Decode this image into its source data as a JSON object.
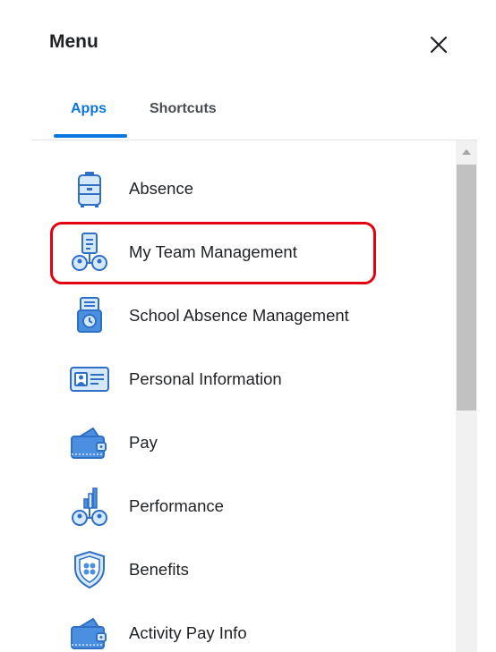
{
  "header": {
    "title": "Menu",
    "close_icon": "close-icon"
  },
  "tabs": [
    {
      "label": "Apps",
      "active": true
    },
    {
      "label": "Shortcuts",
      "active": false
    }
  ],
  "colors": {
    "accent": "#0875e1",
    "highlight": "#e3000f",
    "icon_blue": "#4a8fe0",
    "icon_light": "#d6e8fb"
  },
  "apps": [
    {
      "label": "Absence",
      "icon": "suitcase-icon"
    },
    {
      "label": "My Team Management",
      "icon": "team-clipboard-icon",
      "highlighted": true
    },
    {
      "label": "School Absence Management",
      "icon": "calendar-clock-icon"
    },
    {
      "label": "Personal Information",
      "icon": "id-card-icon"
    },
    {
      "label": "Pay",
      "icon": "wallet-icon"
    },
    {
      "label": "Performance",
      "icon": "team-chart-icon"
    },
    {
      "label": "Benefits",
      "icon": "shield-icon"
    },
    {
      "label": "Activity Pay Info",
      "icon": "wallet-icon"
    }
  ]
}
